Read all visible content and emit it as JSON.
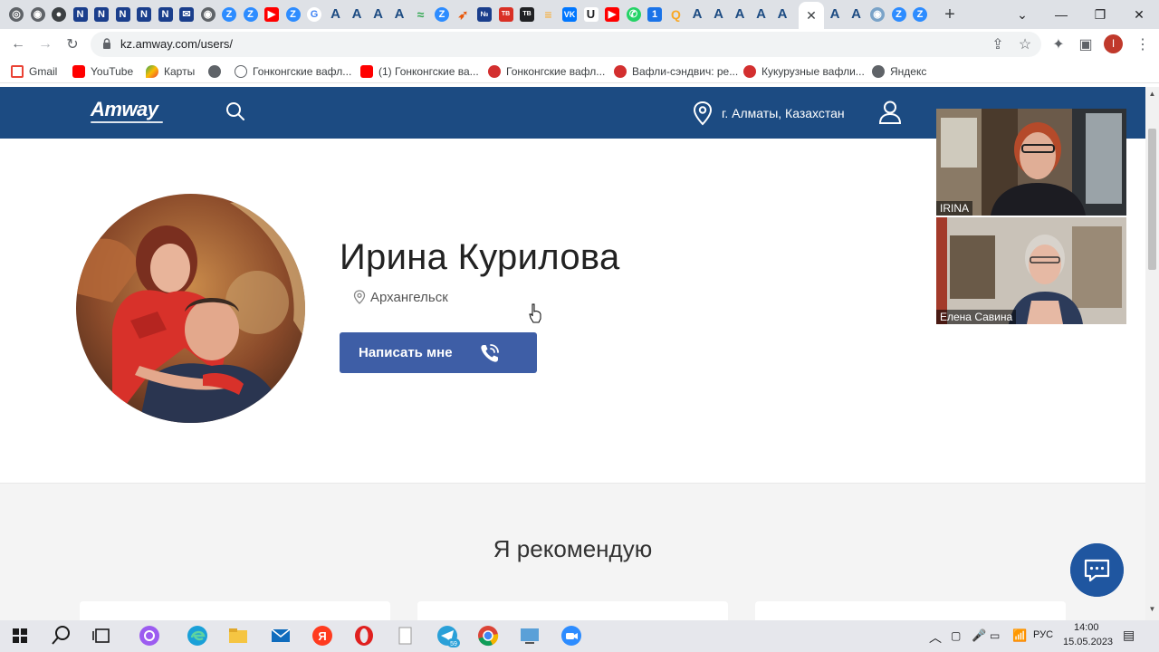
{
  "browser": {
    "url": "kz.amway.com/users/",
    "profile_initial": "I",
    "bookmarks": [
      {
        "label": "Gmail",
        "icon": "gmail-icon"
      },
      {
        "label": "YouTube",
        "icon": "youtube-icon"
      },
      {
        "label": "Карты",
        "icon": "maps-icon"
      },
      {
        "label": "",
        "icon": "globe-icon"
      },
      {
        "label": "Гонконгские вафл...",
        "icon": "link-icon"
      },
      {
        "label": "(1) Гонконгские ва...",
        "icon": "youtube-icon"
      },
      {
        "label": "Гонконгские вафл...",
        "icon": "tomato-icon"
      },
      {
        "label": "Вафли-сэндвич: ре...",
        "icon": "tomato-icon"
      },
      {
        "label": "Кукурузные вафли...",
        "icon": "tomato-icon"
      },
      {
        "label": "Яндекс",
        "icon": "globe-icon"
      }
    ]
  },
  "site": {
    "logo": "Amway",
    "location": "г. Алматы, Казахстан"
  },
  "profile": {
    "name": "Ирина Курилова",
    "city": "Архангельск",
    "write_button": "Написать мне"
  },
  "recommend": {
    "title": "Я рекомендую"
  },
  "call": {
    "participant1": "IRINA",
    "participant2": "Елена Савина"
  },
  "taskbar": {
    "language": "РУС",
    "time": "14:00",
    "date": "15.05.2023",
    "telegram_badge": "59"
  },
  "colors": {
    "header": "#1c4b82",
    "button": "#3e5ea6",
    "chat_fab": "#1f56a0"
  }
}
